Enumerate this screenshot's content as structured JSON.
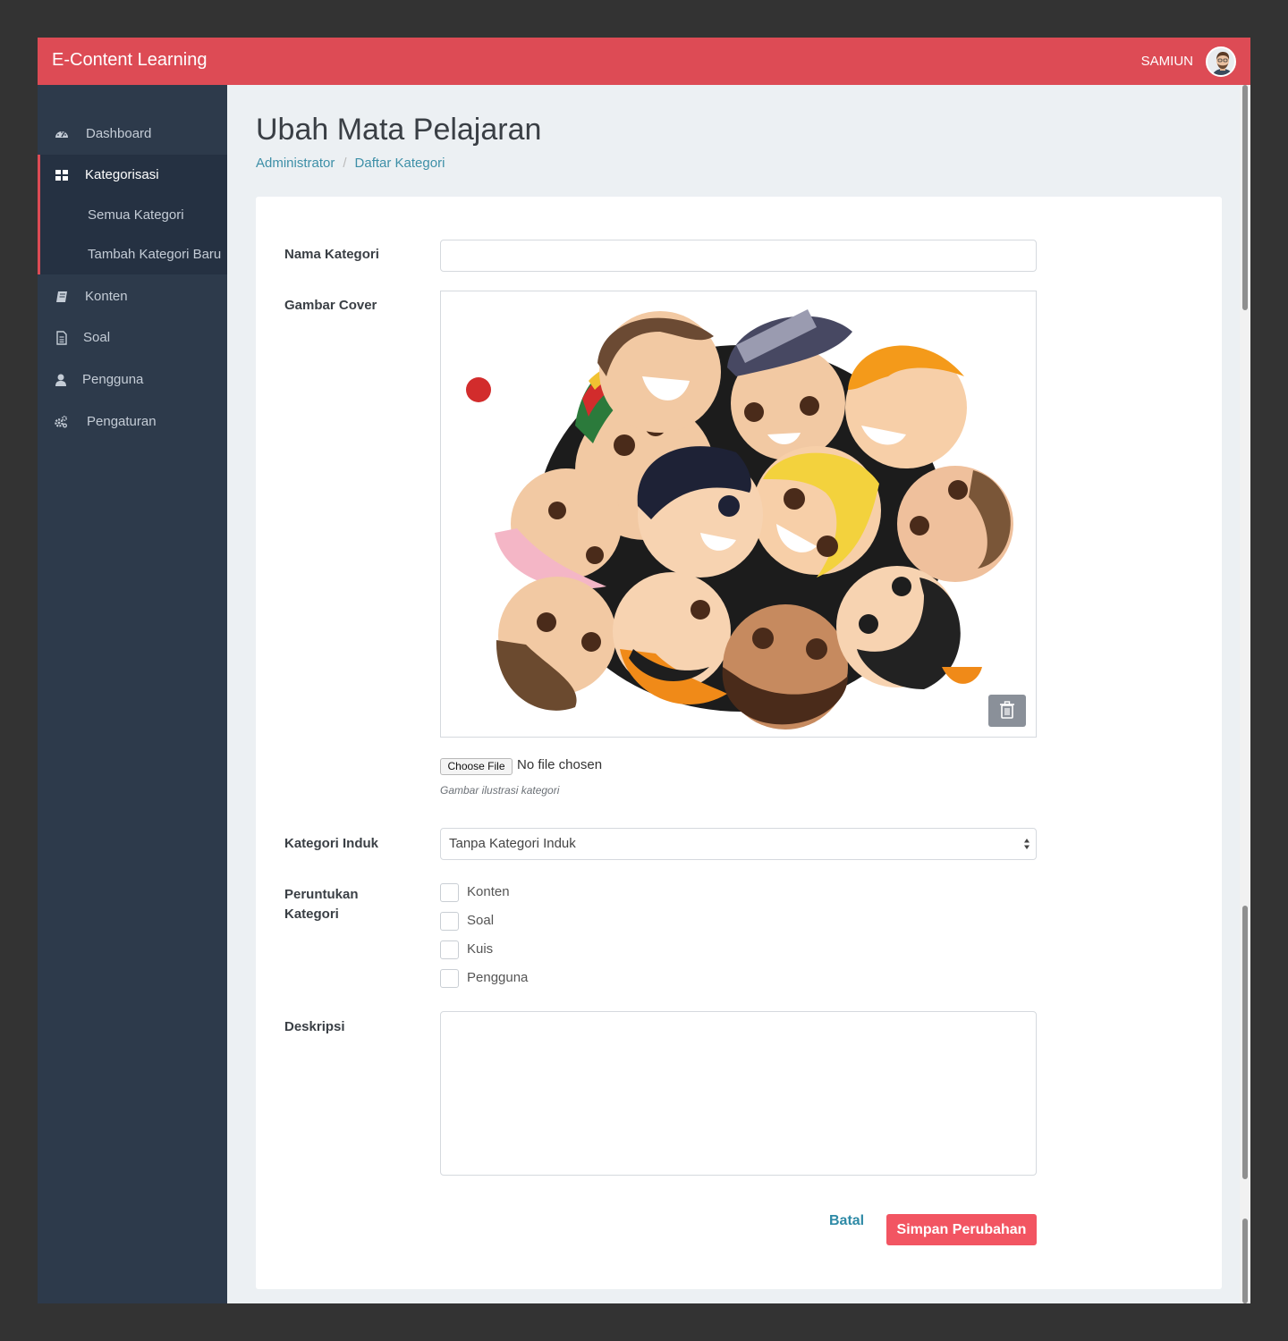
{
  "header": {
    "brand": "E-Content Learning",
    "username": "SAMIUN",
    "brand_color": "#dd4b55"
  },
  "sidebar": {
    "items": [
      {
        "label": "Dashboard",
        "icon": "dashboard-icon"
      },
      {
        "label": "Kategorisasi",
        "icon": "grid-icon",
        "active": true
      },
      {
        "label": "Konten",
        "icon": "book-icon"
      },
      {
        "label": "Soal",
        "icon": "document-icon"
      },
      {
        "label": "Pengguna",
        "icon": "user-icon"
      },
      {
        "label": "Pengaturan",
        "icon": "gears-icon"
      }
    ],
    "subitems": [
      {
        "label": "Semua Kategori"
      },
      {
        "label": "Tambah Kategori Baru"
      }
    ]
  },
  "page": {
    "title": "Ubah Mata Pelajaran",
    "breadcrumb": [
      "Administrator",
      "Daftar Kategori"
    ]
  },
  "form": {
    "nama_label": "Nama Kategori",
    "nama_value": "",
    "cover_label": "Gambar Cover",
    "file_button": "Choose File",
    "file_status": "No file chosen",
    "file_help": "Gambar ilustrasi kategori",
    "induk_label": "Kategori Induk",
    "induk_value": "Tanpa Kategori Induk",
    "peruntukan_label_1": "Peruntukan",
    "peruntukan_label_2": "Kategori",
    "options": [
      {
        "label": "Konten",
        "checked": false
      },
      {
        "label": "Soal",
        "checked": false
      },
      {
        "label": "Kuis",
        "checked": false
      },
      {
        "label": "Pengguna",
        "checked": false
      }
    ],
    "deskripsi_label": "Deskripsi",
    "deskripsi_value": "",
    "cancel_label": "Batal",
    "save_label": "Simpan Perubahan"
  }
}
